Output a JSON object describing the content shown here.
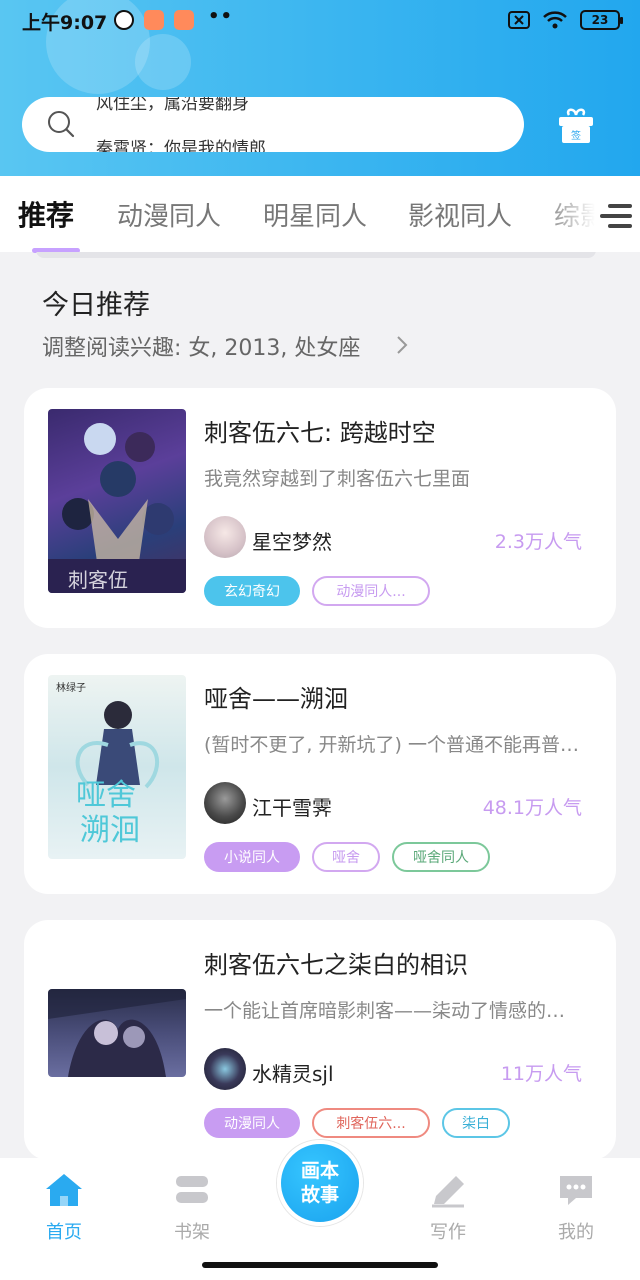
{
  "status_bar": {
    "time": "上午9:07",
    "battery": "23"
  },
  "search": {
    "scroll_items": [
      "风住尘，属沿要翻身",
      "秦霄贤：你是我的情郎"
    ]
  },
  "tabs": [
    {
      "label": "推荐",
      "active": true
    },
    {
      "label": "动漫同人"
    },
    {
      "label": "明星同人"
    },
    {
      "label": "影视同人"
    },
    {
      "label": "综影"
    }
  ],
  "section": {
    "title": "今日推荐",
    "subtitle": "调整阅读兴趣: 女, 2013, 处女座"
  },
  "cards": [
    {
      "title": "刺客伍六七: 跨越时空",
      "desc": "我竟然穿越到了刺客伍六七里面",
      "author": "星空梦然",
      "popularity": "2.3万人气",
      "tags": [
        {
          "label": "玄幻奇幻",
          "style": "filled",
          "color": "#4cc4ec"
        },
        {
          "label": "动漫同人...",
          "style": "outline",
          "color": "#d2a8f0"
        }
      ]
    },
    {
      "title": "哑舍——溯洄",
      "desc": "(暂时不更了, 开新坑了) 一个普通不能再普通的少女……",
      "author": "江干雪霁",
      "popularity": "48.1万人气",
      "cover_text": "林绿子",
      "tags": [
        {
          "label": "小说同人",
          "style": "filled",
          "color": "#c89cf2"
        },
        {
          "label": "哑舍",
          "style": "outline",
          "color": "#d2a8f0"
        },
        {
          "label": "哑舍同人",
          "style": "outline",
          "color": "#7cc89a"
        }
      ]
    },
    {
      "title": "刺客伍六七之柒白的相识",
      "desc": "一个能让首席暗影刺客——柒动了情感的女孩……",
      "author": "水精灵sjl",
      "popularity": "11万人气",
      "tags": [
        {
          "label": "动漫同人",
          "style": "filled",
          "color": "#c89cf2"
        },
        {
          "label": "刺客伍六...",
          "style": "outline",
          "color": "#ef8a80"
        },
        {
          "label": "柒白",
          "style": "outline",
          "color": "#5cc6e6"
        }
      ]
    }
  ],
  "bottom_nav": [
    {
      "label": "首页",
      "icon": "home-icon",
      "active": true
    },
    {
      "label": "书架",
      "icon": "bookshelf-icon"
    },
    {
      "label": "画本故事",
      "icon": "center-create"
    },
    {
      "label": "写作",
      "icon": "pen-icon"
    },
    {
      "label": "我的",
      "icon": "chat-bubble-icon"
    }
  ],
  "colors": {
    "accent": "#2aaaf0",
    "tab_underline": "#c7a1ff",
    "popularity": "#c79bf0"
  }
}
